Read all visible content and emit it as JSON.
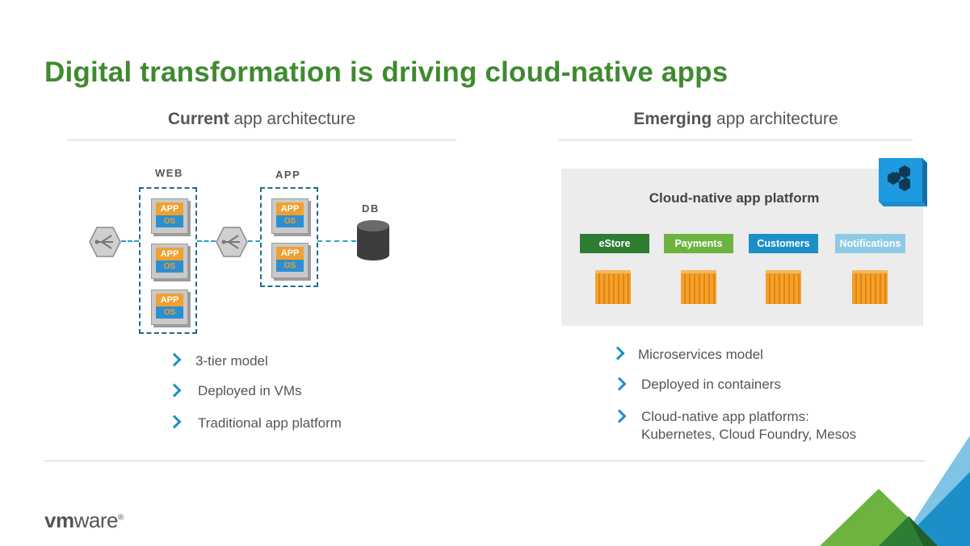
{
  "slide": {
    "title": "Digital transformation is driving cloud-native apps"
  },
  "current": {
    "heading_bold": "Current",
    "heading_rest": " app architecture",
    "tiers": {
      "web_label": "WEB",
      "app_label": "APP",
      "db_label": "DB"
    },
    "vm": {
      "app_text": "APP",
      "os_text": "OS"
    },
    "bullets": [
      "3-tier model",
      "Deployed in VMs",
      "Traditional app platform"
    ]
  },
  "emerging": {
    "heading_bold": "Emerging",
    "heading_rest": " app architecture",
    "platform_title": "Cloud-native app platform",
    "services": [
      {
        "label": "eStore",
        "color": "#2e7d32"
      },
      {
        "label": "Payments",
        "color": "#6cb33f"
      },
      {
        "label": "Customers",
        "color": "#1d8fc8"
      },
      {
        "label": "Notifications",
        "color": "#8ecae6"
      }
    ],
    "bullets": [
      "Microservices model",
      "Deployed in containers"
    ],
    "bullet3_line1": "Cloud-native app platforms:",
    "bullet3_line2": "Kubernetes, Cloud Foundry, Mesos"
  },
  "footer": {
    "logo_text_vm": "vm",
    "logo_text_ware": "ware",
    "logo_reg": "®"
  },
  "colors": {
    "title_green": "#3f8a2f",
    "accent_blue": "#1d8fc8",
    "container_orange": "#f5a02a"
  }
}
